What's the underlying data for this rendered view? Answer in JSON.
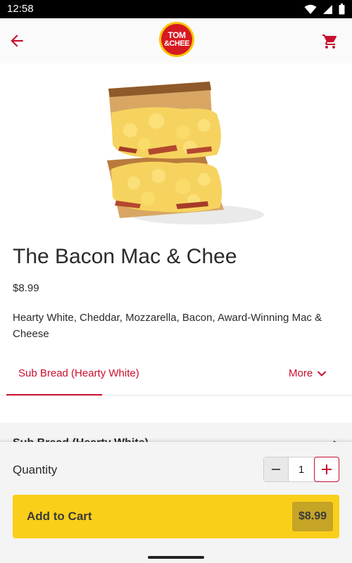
{
  "status_bar": {
    "time": "12:58"
  },
  "app_bar": {
    "logo_line1": "TOM",
    "logo_line2": "&CHEE"
  },
  "product": {
    "name": "The Bacon Mac & Chee",
    "price": "$8.99",
    "description": "Hearty White, Cheddar, Mozzarella, Bacon, Award-Winning Mac & Cheese"
  },
  "tabs": {
    "active_label": "Sub Bread (Hearty White)",
    "more_label": "More"
  },
  "section": {
    "header_label": "Sub Bread (Hearty White)"
  },
  "quantity": {
    "label": "Quantity",
    "value": "1"
  },
  "add_to_cart": {
    "label": "Add to Cart",
    "price": "$8.99"
  },
  "colors": {
    "brand_red": "#c8102e",
    "cta_yellow": "#f9cf1a",
    "price_chip": "#c6a425"
  },
  "icons": [
    "back-arrow-icon",
    "cart-icon",
    "chevron-down-icon",
    "minus-icon",
    "plus-icon",
    "wifi-icon",
    "signal-icon",
    "battery-icon"
  ]
}
